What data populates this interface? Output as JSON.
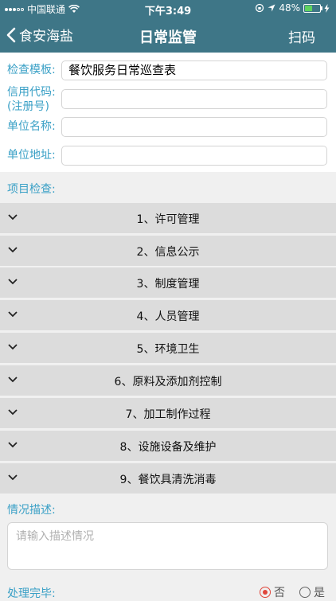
{
  "status_bar": {
    "carrier": "中国联通",
    "time": "下午3:49",
    "battery": "48%",
    "battery_level": 0.48
  },
  "nav": {
    "back_label": "食安海盐",
    "title": "日常监管",
    "right_action": "扫码"
  },
  "form": {
    "template_label": "检查模板:",
    "template_value": "餐饮服务日常巡查表",
    "credit_label_line1": "信用代码:",
    "credit_label_line2": "(注册号)",
    "credit_value": "",
    "unit_name_label": "单位名称:",
    "unit_name_value": "",
    "unit_address_label": "单位地址:",
    "unit_address_value": ""
  },
  "inspection": {
    "section_label": "项目检查:",
    "items": [
      "1、许可管理",
      "2、信息公示",
      "3、制度管理",
      "4、人员管理",
      "5、环境卫生",
      "6、原料及添加剂控制",
      "7、加工制作过程",
      "8、设施设备及维护",
      "9、餐饮具清洗消毒"
    ]
  },
  "description": {
    "label": "情况描述:",
    "placeholder": "请输入描述情况"
  },
  "completion": {
    "label": "处理完毕:",
    "option_no": "否",
    "option_yes": "是",
    "selected": "否"
  },
  "colors": {
    "header_bg": "#3e7687",
    "label_blue": "#3aa0c6",
    "radio_selected": "#e0463b",
    "accordion_bg": "#dcdcdc"
  }
}
